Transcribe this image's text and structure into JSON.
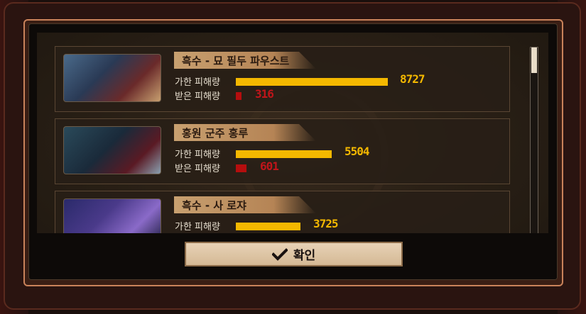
{
  "dialog": {
    "confirm_label": "확인",
    "confirm_icon": "check-icon"
  },
  "labels": {
    "dealt": "가한 피해량",
    "taken": "받은 피해량"
  },
  "entries": [
    {
      "name": "흑수 - 묘 필두 파우스트",
      "damage_dealt": "8727",
      "damage_taken": "316",
      "dealt_fraction": 1.0,
      "taken_fraction": 0.036
    },
    {
      "name": "홍원 군주 홍루",
      "damage_dealt": "5504",
      "damage_taken": "601",
      "dealt_fraction": 0.631,
      "taken_fraction": 0.069
    },
    {
      "name": "흑수 - 사 로쟈",
      "damage_dealt": "3725",
      "damage_taken": "",
      "dealt_fraction": 0.427,
      "taken_fraction": 0
    }
  ],
  "colors": {
    "dealt_bar": "#f4b800",
    "taken_bar": "#b50e0e",
    "name_tag": "#c8a070"
  }
}
